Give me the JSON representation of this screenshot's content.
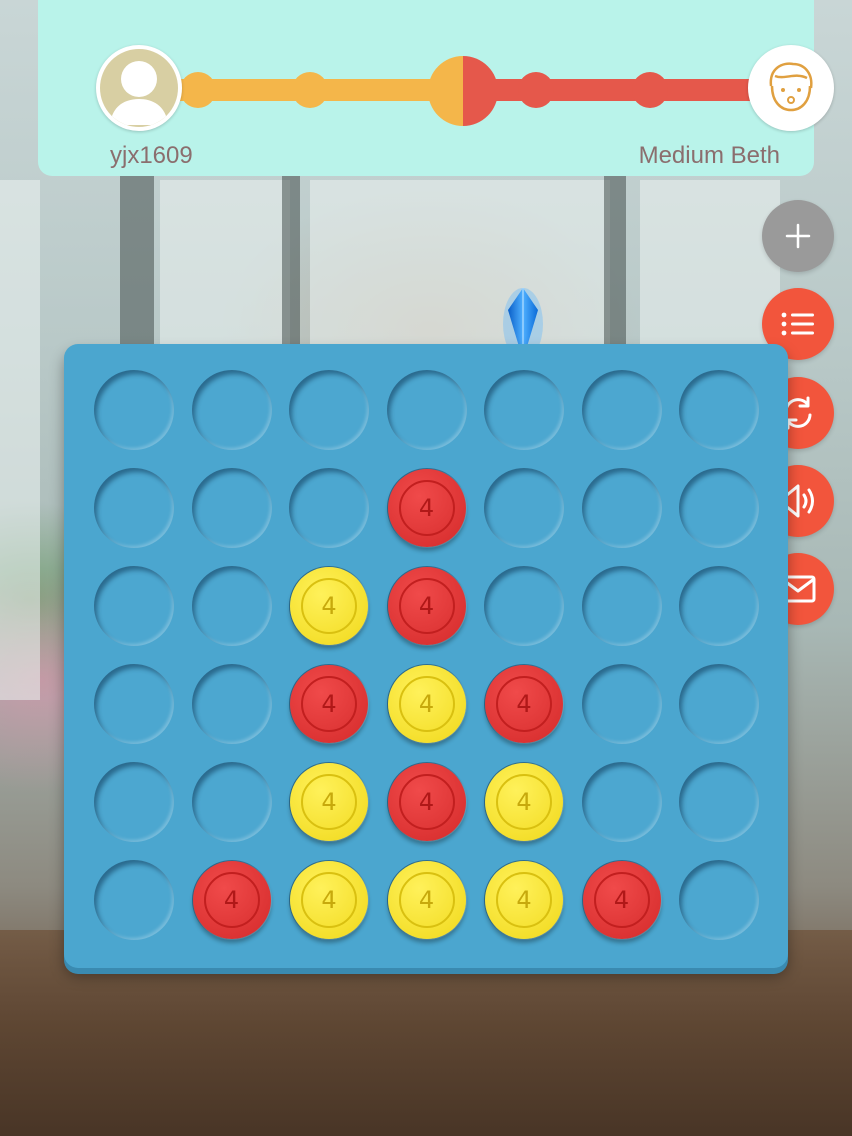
{
  "players": {
    "left": {
      "name": "yjx1609",
      "color": "#f4b64a"
    },
    "right": {
      "name": "Medium Beth",
      "color": "#e5584b"
    }
  },
  "side_buttons": [
    {
      "name": "add-button",
      "icon": "plus-icon",
      "color": "#9a9a9a"
    },
    {
      "name": "menu-button",
      "icon": "list-icon",
      "color": "#f2553c"
    },
    {
      "name": "restart-button",
      "icon": "refresh-icon",
      "color": "#f2553c"
    },
    {
      "name": "sound-button",
      "icon": "speaker-icon",
      "color": "#f2553c"
    },
    {
      "name": "message-button",
      "icon": "mail-icon",
      "color": "#f2553c"
    }
  ],
  "board": {
    "columns": 7,
    "rows": 6,
    "selected_column": 5,
    "disc_label": "4",
    "colors": {
      "board": "#4ba6cf",
      "red": "#e03535",
      "yellow": "#f5e030"
    },
    "cells": [
      [
        "",
        "",
        "",
        "",
        "",
        "",
        ""
      ],
      [
        "",
        "",
        "",
        "R",
        "",
        "",
        ""
      ],
      [
        "",
        "",
        "Y",
        "R",
        "",
        "",
        ""
      ],
      [
        "",
        "",
        "R",
        "Y",
        "R",
        "",
        ""
      ],
      [
        "",
        "",
        "Y",
        "R",
        "Y",
        "",
        ""
      ],
      [
        "",
        "R",
        "Y",
        "Y",
        "Y",
        "R",
        ""
      ]
    ]
  }
}
